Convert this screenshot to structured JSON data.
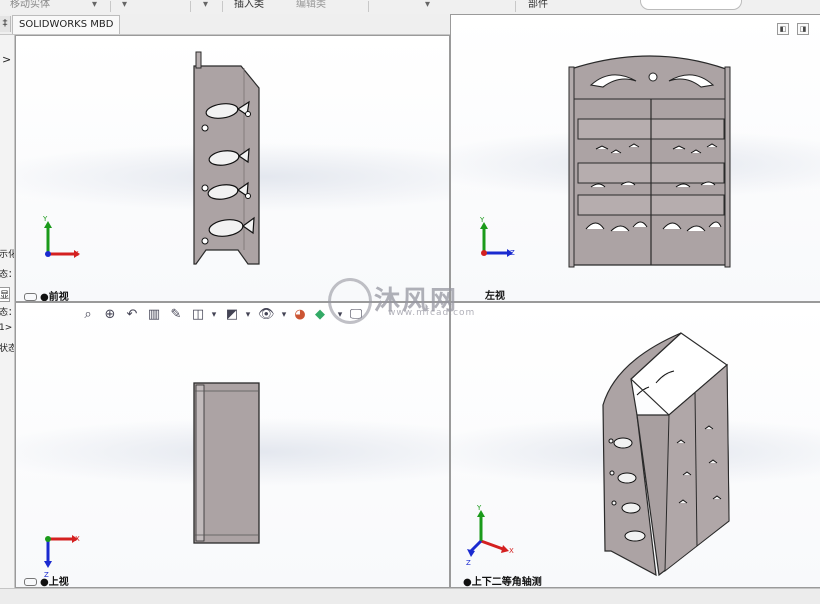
{
  "topbar": {
    "item1": "移动实体",
    "item2": "插入类",
    "item3": "编辑类",
    "item4": "部件"
  },
  "tabs": {
    "pin": "‡",
    "mbd_tab": "SOLIDWORKS MBD"
  },
  "left_panel": {
    "chevron": ">",
    "labels": [
      "示化",
      "态：",
      "显",
      "态：",
      "1>",
      "状态"
    ]
  },
  "viewports": {
    "front": {
      "label": "前视"
    },
    "left": {
      "label": "左视"
    },
    "top": {
      "label": "上视"
    },
    "iso": {
      "label": "上下二等角轴测"
    }
  },
  "triad": {
    "x": "X",
    "y": "Y",
    "z": "Z"
  },
  "watermark": {
    "brand": "沐风网",
    "url": "www.mfcad.com"
  },
  "colors": {
    "part": "#aca3a4",
    "edge": "#2a2a2a",
    "x_axis": "#d42020",
    "y_axis": "#1a9a1a",
    "z_axis": "#1a2ad0"
  }
}
